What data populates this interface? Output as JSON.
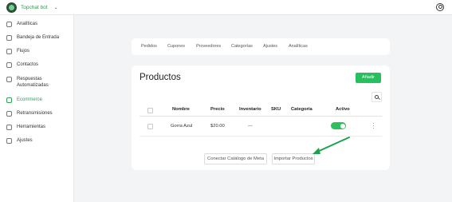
{
  "header": {
    "brand": "Topchat bot",
    "accent": "#27c05e"
  },
  "sidebar": {
    "items": [
      {
        "label": "Analíticas",
        "icon": "chart-icon"
      },
      {
        "label": "Bandeja de Entrada",
        "icon": "inbox-icon"
      },
      {
        "label": "Flujos",
        "icon": "flow-icon"
      },
      {
        "label": "Contactos",
        "icon": "contacts-icon"
      },
      {
        "label": "Respuestas Automatizadas",
        "icon": "auto-reply-icon"
      },
      {
        "label": "Ecommerce",
        "icon": "cart-icon",
        "active": true
      },
      {
        "label": "Retransmisiones",
        "icon": "broadcast-icon"
      },
      {
        "label": "Herramientas",
        "icon": "tools-icon"
      },
      {
        "label": "Ajustes",
        "icon": "settings-icon"
      }
    ]
  },
  "tabs": [
    "Pedidos",
    "Cupones",
    "Proveedores",
    "Categorías",
    "Ajustes",
    "Analíticas"
  ],
  "products": {
    "title": "Productos",
    "add_label": "Añadir",
    "columns": [
      "Nombre",
      "Precio",
      "Inventario",
      "SKU",
      "Categoría",
      "Activo"
    ],
    "rows": [
      {
        "name": "Gorra Azul",
        "price": "$20.00",
        "inventory": "---",
        "sku": "",
        "category": "",
        "active": true
      }
    ],
    "connect_label": "Conectar Catálogo de Meta",
    "import_label": "Importar Productos"
  }
}
